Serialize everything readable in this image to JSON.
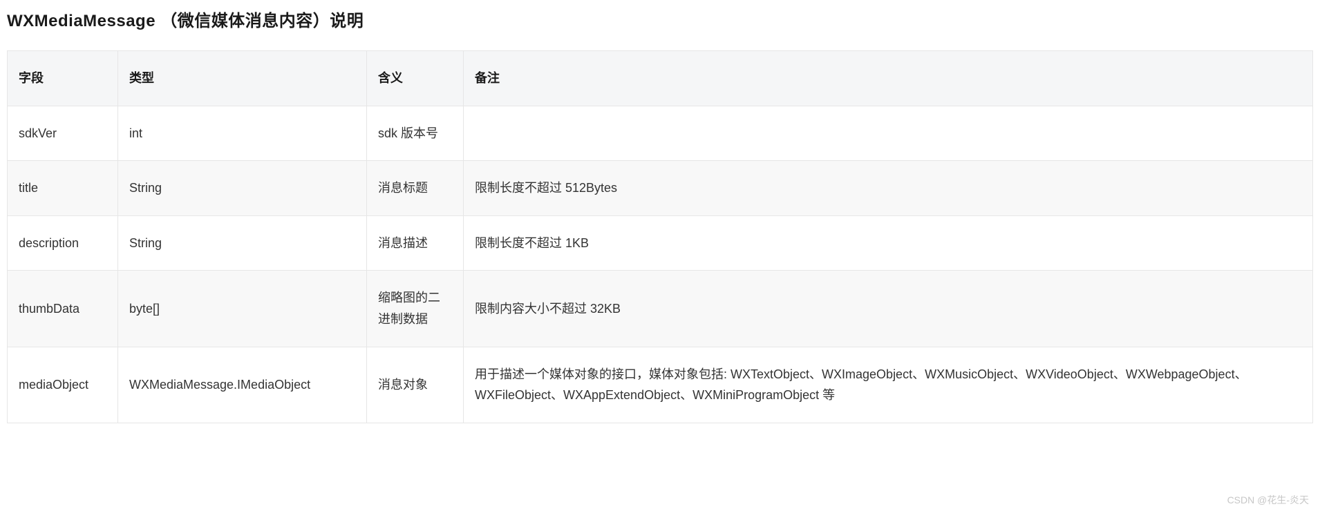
{
  "heading": "WXMediaMessage （微信媒体消息内容）说明",
  "table": {
    "headers": {
      "field": "字段",
      "type": "类型",
      "meaning": "含义",
      "remark": "备注"
    },
    "rows": [
      {
        "field": "sdkVer",
        "type": "int",
        "meaning": "sdk 版本号",
        "remark": ""
      },
      {
        "field": "title",
        "type": "String",
        "meaning": "消息标题",
        "remark": "限制长度不超过 512Bytes"
      },
      {
        "field": "description",
        "type": "String",
        "meaning": "消息描述",
        "remark": "限制长度不超过 1KB"
      },
      {
        "field": "thumbData",
        "type": "byte[]",
        "meaning": "缩略图的二进制数据",
        "remark": "限制内容大小不超过 32KB"
      },
      {
        "field": "mediaObject",
        "type": "WXMediaMessage.IMediaObject",
        "meaning": "消息对象",
        "remark": "用于描述一个媒体对象的接口，媒体对象包括: WXTextObject、WXImageObject、WXMusicObject、WXVideoObject、WXWebpageObject、 WXFileObject、WXAppExtendObject、WXMiniProgramObject 等"
      }
    ]
  },
  "watermark": "CSDN @花生-炎天"
}
